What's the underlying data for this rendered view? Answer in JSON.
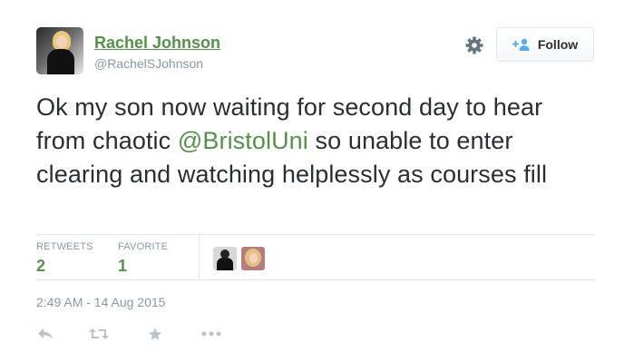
{
  "user": {
    "name": "Rachel Johnson",
    "handle": "@RachelSJohnson"
  },
  "header": {
    "follow_label": "Follow",
    "gear_icon": "gear-icon",
    "follow_icon": "add-user-icon"
  },
  "tweet": {
    "text_before": "Ok my son now waiting for second day to hear from chaotic ",
    "mention": "@BristolUni",
    "text_after": " so unable to enter clearing and watching helplessly as courses fill"
  },
  "stats": {
    "retweets_label": "RETWEETS",
    "retweets_value": "2",
    "favorites_label": "FAVORITE",
    "favorites_value": "1"
  },
  "timestamp": "2:49 AM - 14 Aug 2015",
  "actions": [
    "reply-icon",
    "retweet-icon",
    "favorite-icon",
    "more-icon"
  ],
  "colors": {
    "accent": "#55914a",
    "muted": "#8899a6",
    "text": "#292f33",
    "border": "#e1e8ed"
  }
}
